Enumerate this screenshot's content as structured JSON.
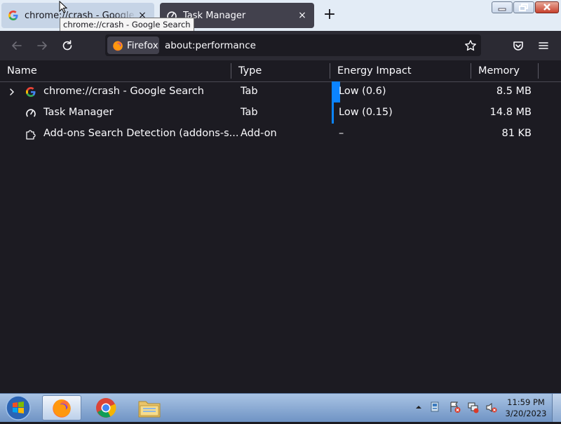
{
  "browser": {
    "tabs": [
      {
        "title": "chrome://crash - Google Search",
        "icon": "google-icon",
        "close": "×"
      },
      {
        "title": "Task Manager",
        "icon": "gauge-icon",
        "close": "×"
      }
    ],
    "new_tab": "+",
    "tooltip": "chrome://crash - Google Search",
    "identity_label": "Firefox",
    "url": "about:performance"
  },
  "table": {
    "columns": [
      "Name",
      "Type",
      "Energy Impact",
      "Memory"
    ],
    "rows": [
      {
        "name": "chrome://crash - Google Search",
        "type": "Tab",
        "energy": "Low (0.6)",
        "memory": "8.5 MB",
        "expandable": true,
        "icon": "google-icon"
      },
      {
        "name": "Task Manager",
        "type": "Tab",
        "energy": "Low (0.15)",
        "memory": "14.8 MB",
        "expandable": false,
        "icon": "gauge-icon"
      },
      {
        "name": "Add-ons Search Detection (addons-s...",
        "type": "Add-on",
        "energy": "–",
        "memory": "81 KB",
        "expandable": false,
        "icon": "puzzle-icon"
      }
    ]
  },
  "taskbar": {
    "apps": [
      "firefox-icon",
      "chrome-icon",
      "file-explorer-icon"
    ],
    "clock_time": "11:59 PM",
    "clock_date": "3/20/2023"
  },
  "colors": {
    "accent": "#0b84ff",
    "background": "#1c1b22",
    "toolbar": "#2b2a33"
  }
}
